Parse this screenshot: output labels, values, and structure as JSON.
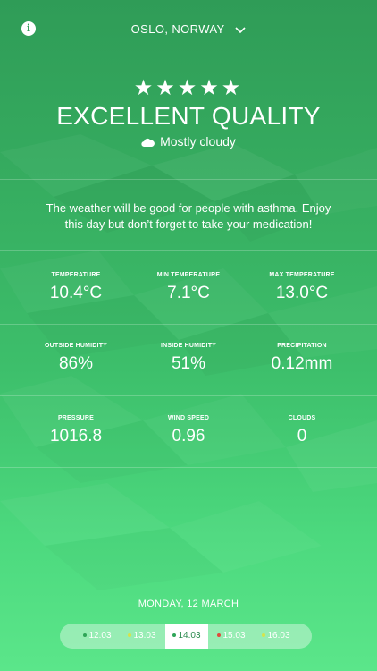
{
  "header": {
    "info_icon": "info-icon",
    "location": "OSLO, NORWAY",
    "dropdown_icon": "chevron-down-icon"
  },
  "summary": {
    "rating": 5,
    "rating_max": 5,
    "stars": "★★★★★",
    "quality": "EXCELLENT QUALITY",
    "condition_icon": "cloud-icon",
    "condition": "Mostly cloudy"
  },
  "advice": "The weather will be good for people with asthma. Enjoy this day but don’t forget to take your medication!",
  "stats": [
    [
      {
        "label": "TEMPERATURE",
        "value": "10.4°C"
      },
      {
        "label": "MIN TEMPERATURE",
        "value": "7.1°C"
      },
      {
        "label": "MAX TEMPERATURE",
        "value": "13.0°C"
      }
    ],
    [
      {
        "label": "OUTSIDE HUMIDITY",
        "value": "86%"
      },
      {
        "label": "INSIDE HUMIDITY",
        "value": "51%"
      },
      {
        "label": "PRECIPITATION",
        "value": "0.12mm"
      }
    ],
    [
      {
        "label": "PRESSURE",
        "value": "1016.8"
      },
      {
        "label": "WIND SPEED",
        "value": "0.96"
      },
      {
        "label": "CLOUDS",
        "value": "0"
      }
    ]
  ],
  "date_label": "MONDAY, 12 MARCH",
  "days": [
    {
      "label": "12.03",
      "dot_color": "#2fa558",
      "selected": false
    },
    {
      "label": "13.03",
      "dot_color": "#d6e34a",
      "selected": false
    },
    {
      "label": "14.03",
      "dot_color": "#2fa558",
      "selected": true
    },
    {
      "label": "15.03",
      "dot_color": "#e04a3c",
      "selected": false
    },
    {
      "label": "16.03",
      "dot_color": "#d6e34a",
      "selected": false
    }
  ],
  "colors": {
    "top": "#2f9c57",
    "bottom": "#5be68a",
    "accent": "#2a8a4d"
  }
}
